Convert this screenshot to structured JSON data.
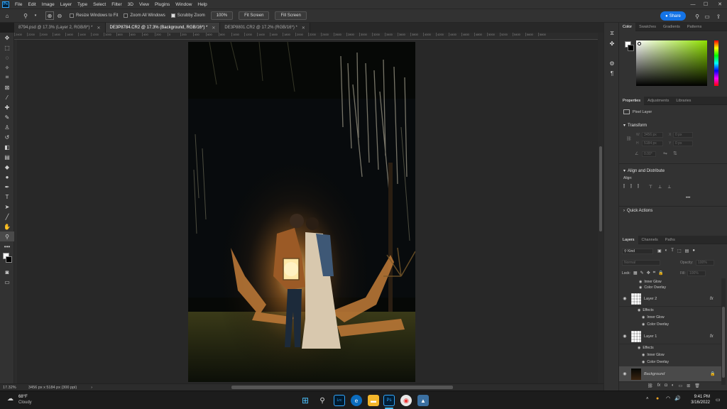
{
  "menubar": {
    "logo": "Ps",
    "items": [
      "File",
      "Edit",
      "Image",
      "Layer",
      "Type",
      "Select",
      "Filter",
      "3D",
      "View",
      "Plugins",
      "Window",
      "Help"
    ],
    "minimize": "—",
    "maximize": "☐",
    "close": "✕"
  },
  "options": {
    "resize_windows": "Resize Windows to Fit",
    "zoom_all": "Zoom All Windows",
    "scrubby_zoom": "Scrubby Zoom",
    "zoom_level": "100%",
    "fit_screen": "Fit Screen",
    "fill_screen": "Fill Screen",
    "share": "Share"
  },
  "tabs": [
    {
      "label": "8794.psd @ 17.3% (Layer 2, RGB/8*) *"
    },
    {
      "label": "DE3P8784.CR2 @ 17.3% (Background, RGB/16*) *"
    },
    {
      "label": "DE3P8801.CR2 @ 17.2% (RGB/16*) *"
    }
  ],
  "ruler": [
    "2400",
    "2200",
    "2000",
    "1800",
    "1600",
    "1400",
    "1200",
    "1000",
    "800",
    "600",
    "400",
    "200",
    "0",
    "200",
    "400",
    "600",
    "800",
    "1000",
    "1200",
    "1400",
    "1600",
    "1800",
    "2000",
    "2200",
    "2400",
    "2600",
    "2800",
    "3000",
    "3200",
    "3400",
    "3600",
    "3800",
    "4000",
    "4200",
    "4400",
    "4600",
    "4800",
    "5000",
    "5200",
    "5400",
    "5600",
    "5800"
  ],
  "status": {
    "zoom": "17.32%",
    "dims": "3456 px x 5184 px (300 ppi)",
    "arrow": "›"
  },
  "panels": {
    "color_tabs": [
      "Color",
      "Swatches",
      "Gradients",
      "Patterns"
    ],
    "props_tabs": [
      "Properties",
      "Adjustments",
      "Libraries"
    ],
    "pixel_layer": "Pixel Layer",
    "transform": "Transform",
    "w_label": "W",
    "h_label": "H",
    "x_label": "X",
    "y_label": "Y",
    "w_value": "3456 px",
    "h_value": "5184 px",
    "x_value": "0 px",
    "y_value": "0 px",
    "angle_value": "0.00°",
    "align_distribute": "Align and Distribute",
    "align_label": "Align:",
    "more": "•••",
    "quick_actions": "Quick Actions",
    "layers_tabs": [
      "Layers",
      "Channels",
      "Paths"
    ],
    "kind": "Kind",
    "blend": "Normal",
    "opacity_label": "Opacity:",
    "opacity": "100%",
    "lock_label": "Lock:",
    "fill_label": "Fill:",
    "fill": "100%",
    "effects_label": "Effects",
    "inner_glow": "Inner Glow",
    "color_overlay": "Color Overlay",
    "fx": "fx",
    "layers": [
      {
        "name": "Layer 2"
      },
      {
        "name": "Layer 1"
      },
      {
        "name": "Background"
      }
    ]
  },
  "taskbar": {
    "temp": "68°F",
    "weather": "Cloudy",
    "time": "9:41 PM",
    "date": "3/16/2022",
    "icons": {
      "lr": "Lrc",
      "ps": "Ps"
    }
  },
  "colors": {
    "accent": "#1473e6",
    "ps_blue": "#31a8ff",
    "panel_bg": "#323232"
  }
}
